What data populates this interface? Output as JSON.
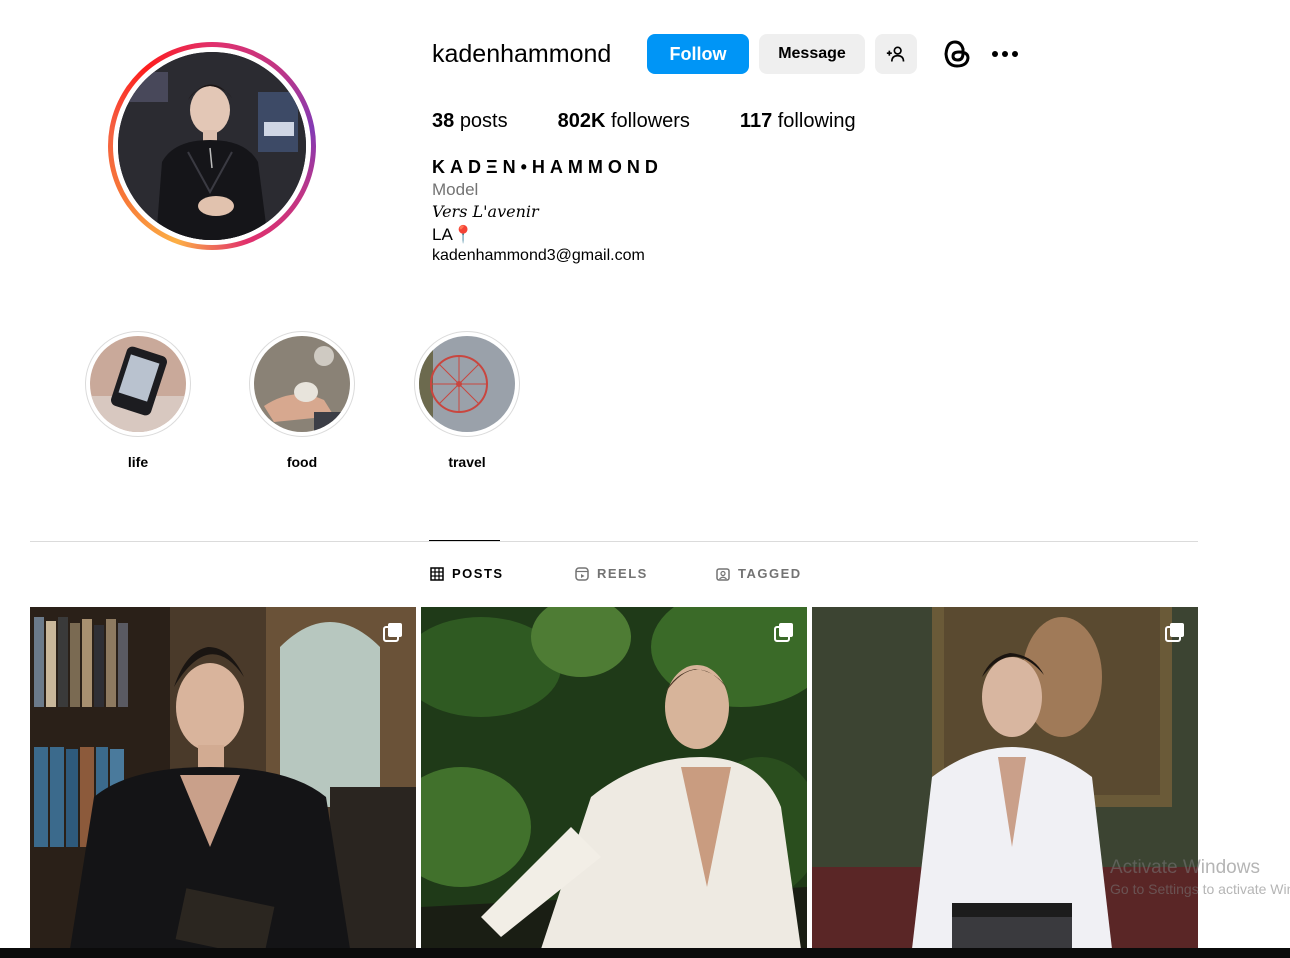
{
  "profile": {
    "username": "kadenhammond",
    "follow_label": "Follow",
    "message_label": "Message",
    "icons": {
      "add_user": "person-add-icon",
      "threads": "threads-icon",
      "more": "more-options-icon"
    }
  },
  "stats": {
    "posts_count": "38",
    "posts_label": "posts",
    "followers_count": "802K",
    "followers_label": "followers",
    "following_count": "117",
    "following_label": "following"
  },
  "bio": {
    "display_name": "KADΞN•HAMMOND",
    "category": "Model",
    "tagline": "Vers L'avenir",
    "location": "LA📍",
    "email": "kadenhammond3@gmail.com"
  },
  "highlights": [
    {
      "label": "life"
    },
    {
      "label": "food"
    },
    {
      "label": "travel"
    }
  ],
  "tabs": [
    {
      "label": "POSTS",
      "icon": "grid-icon",
      "active": true
    },
    {
      "label": "REELS",
      "icon": "reels-icon",
      "active": false
    },
    {
      "label": "TAGGED",
      "icon": "tagged-icon",
      "active": false
    }
  ],
  "posts": [
    {
      "multi": true
    },
    {
      "multi": true
    },
    {
      "multi": true
    }
  ],
  "watermark": {
    "title": "Activate Windows",
    "subtitle": "Go to Settings to activate Windows."
  },
  "colors": {
    "accent": "#0095f6",
    "button_gray": "#efefef",
    "muted_text": "#737373",
    "divider": "#dbdbdb"
  }
}
